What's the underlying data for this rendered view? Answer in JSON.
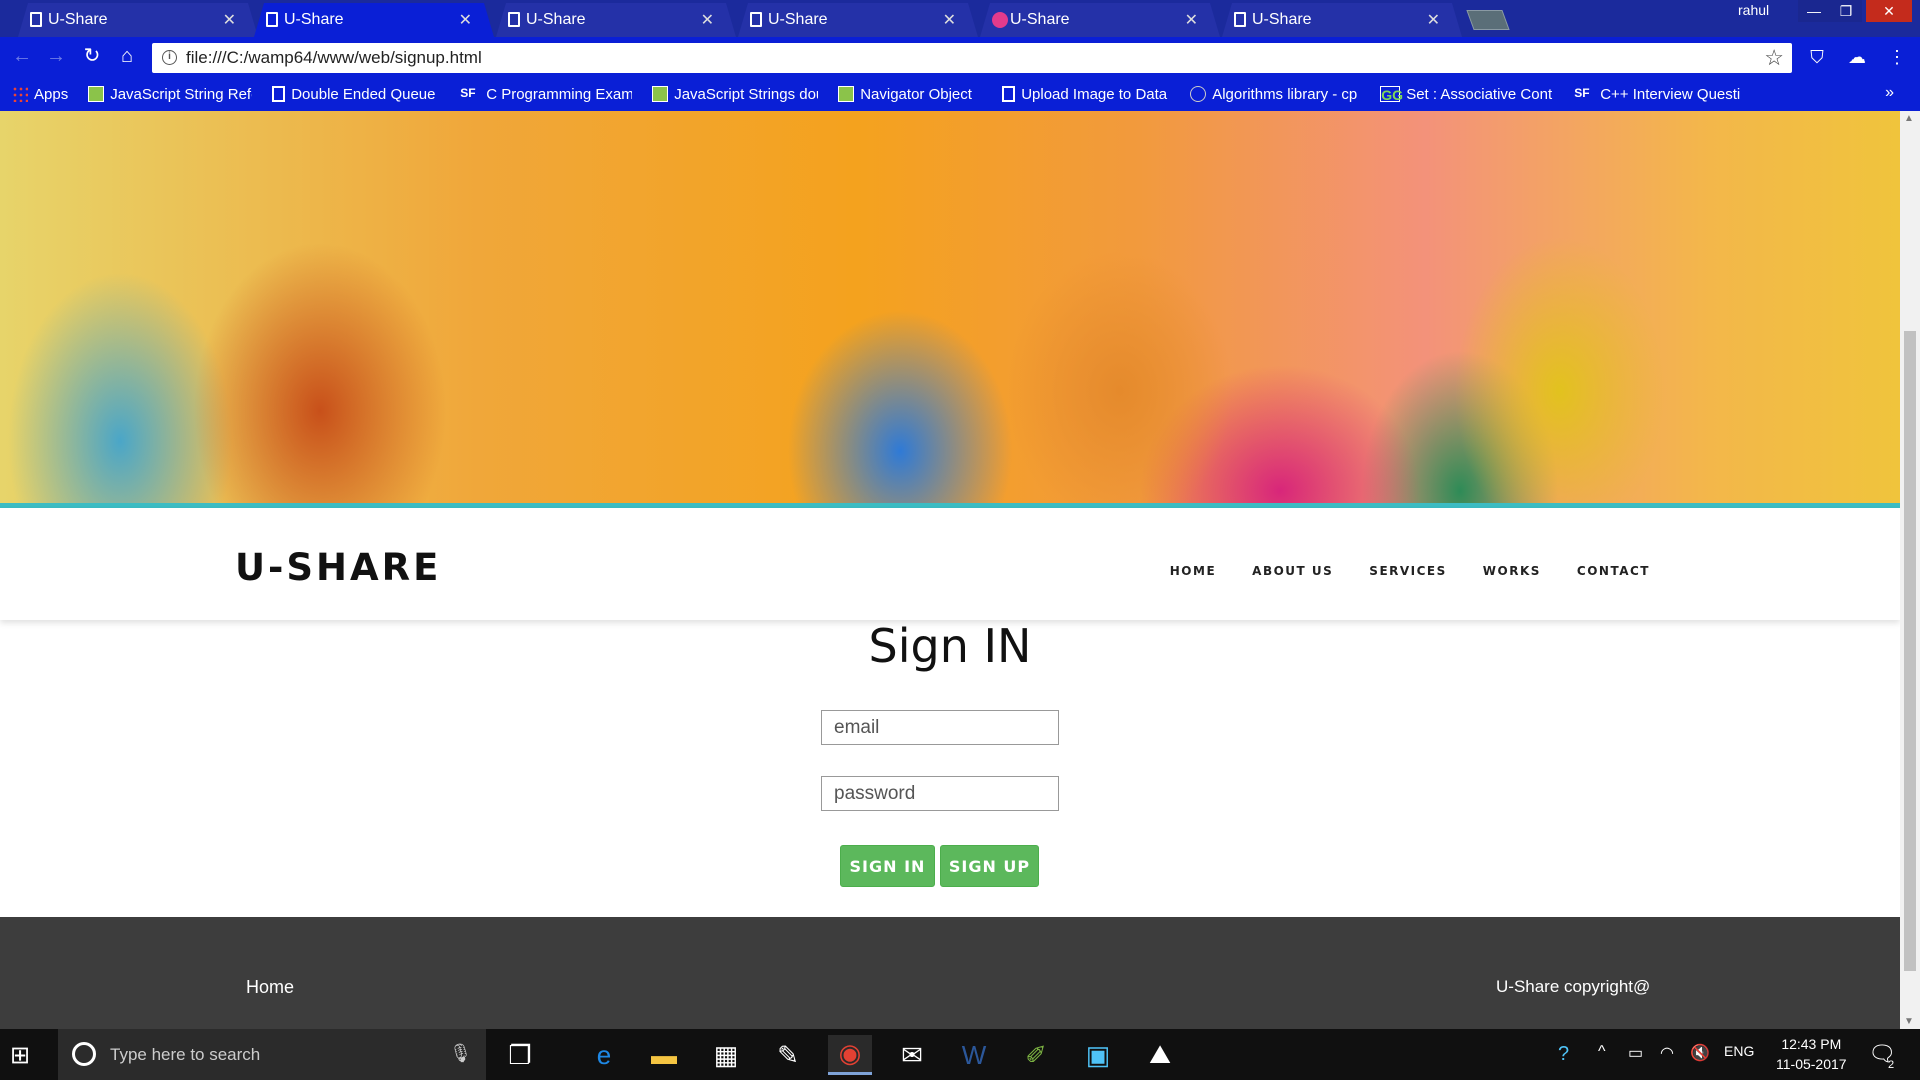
{
  "browser": {
    "tabs": [
      {
        "title": "U-Share",
        "active": false
      },
      {
        "title": "U-Share",
        "active": true
      },
      {
        "title": "U-Share",
        "active": false
      },
      {
        "title": "U-Share",
        "active": false
      },
      {
        "title": "U-Share",
        "active": false
      },
      {
        "title": "U-Share",
        "active": false
      }
    ],
    "user": "rahul",
    "url": "file:///C:/wamp64/www/web/signup.html",
    "bookmarks": [
      {
        "label": "Apps",
        "icon": "apps-grid-icon"
      },
      {
        "label": "JavaScript String Refe",
        "icon": "image-icon"
      },
      {
        "label": "Double Ended Queue",
        "icon": "page-icon"
      },
      {
        "label": "C Programming Exam",
        "icon": "sf-icon"
      },
      {
        "label": "JavaScript Strings dou",
        "icon": "image-icon"
      },
      {
        "label": "Navigator Object",
        "icon": "image-icon"
      },
      {
        "label": "Upload Image to Data",
        "icon": "page-icon"
      },
      {
        "label": "Algorithms library - cp",
        "icon": "algo-icon"
      },
      {
        "label": "Set : Associative Cont",
        "icon": "gfg-icon"
      },
      {
        "label": "C++ Interview Questi",
        "icon": "sf-icon"
      }
    ],
    "more": "»",
    "accent": "#0a1fd6"
  },
  "site": {
    "brand": "U-SHARE",
    "nav": [
      "HOME",
      "ABOUT US",
      "SERVICES",
      "WORKS",
      "CONTACT"
    ],
    "form": {
      "title": "Sign IN",
      "email_placeholder": "email",
      "password_placeholder": "password",
      "signin_label": "SIGN IN",
      "signup_label": "SIGN UP",
      "button_color": "#5cb85c"
    },
    "footer": {
      "home": "Home",
      "copyright": "U-Share copyright@"
    },
    "accent_line": "#3cbcc3"
  },
  "taskbar": {
    "search_placeholder": "Type here to search",
    "language": "ENG",
    "time": "12:43 PM",
    "date": "11-05-2017",
    "notifications": "2"
  }
}
